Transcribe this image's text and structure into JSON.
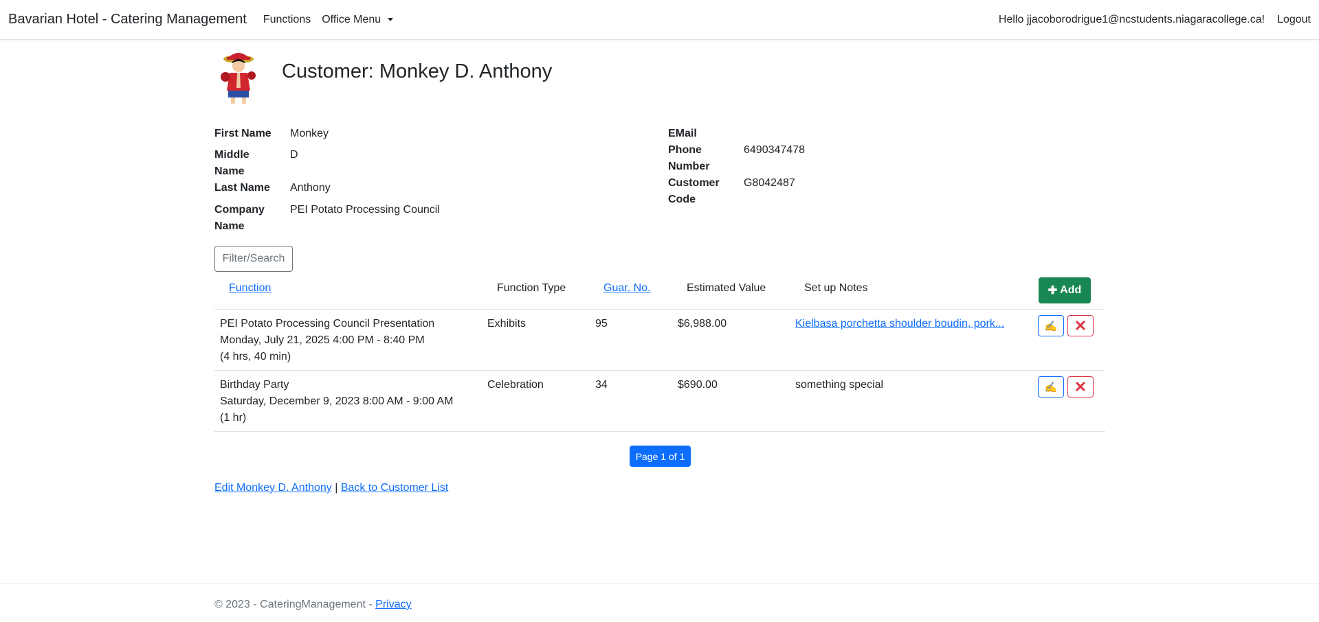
{
  "nav": {
    "brand": "Bavarian Hotel - Catering Management",
    "functions": "Functions",
    "office_menu": "Office Menu",
    "greeting": "Hello jjacoborodrigue1@ncstudents.niagaracollege.ca!",
    "logout": "Logout"
  },
  "title": "Customer: Monkey D. Anthony",
  "details": {
    "first_name_label": "First Name",
    "first_name": "Monkey",
    "middle_label": "Middle",
    "middle_label2": "Name",
    "middle_name": "D",
    "last_name_label": "Last Name",
    "last_name": "Anthony",
    "company_label": "Company",
    "company_label2": "Name",
    "company": "PEI Potato Processing Council",
    "email_label": "EMail",
    "phone_label": "Phone",
    "phone_label2": "Number",
    "phone": "6490347478",
    "code_label": "Customer",
    "code_label2": "Code",
    "code": "G8042487"
  },
  "filter_label": "Filter/Search",
  "table": {
    "headers": {
      "function": "Function",
      "type": "Function Type",
      "guar": "Guar. No.",
      "value": "Estimated Value",
      "notes": "Set up Notes"
    },
    "add_label": "Add",
    "rows": [
      {
        "name": "PEI Potato Processing Council Presentation",
        "date": "Monday, July 21, 2025 4:00 PM - 8:40 PM",
        "duration": "(4 hrs, 40 min)",
        "type": "Exhibits",
        "guar": "95",
        "value": "$6,988.00",
        "notes": "Kielbasa porchetta shoulder boudin, pork..."
      },
      {
        "name": "Birthday Party",
        "date": "Saturday, December 9, 2023 8:00 AM - 9:00 AM",
        "duration": "(1 hr)",
        "type": "Celebration",
        "guar": "34",
        "value": "$690.00",
        "notes": "something special"
      }
    ]
  },
  "pager": "Page 1 of 1",
  "links": {
    "edit": "Edit Monkey D. Anthony",
    "separator": "|",
    "back": "Back to Customer List"
  },
  "footer": {
    "text": "© 2023 - CateringManagement - ",
    "privacy": "Privacy"
  },
  "icons": {
    "edit": "pencil-hand-icon",
    "delete": "x-icon",
    "add": "plus-icon"
  },
  "colors": {
    "primary": "#0d6efd",
    "success": "#198754",
    "danger": "#dc3545"
  }
}
